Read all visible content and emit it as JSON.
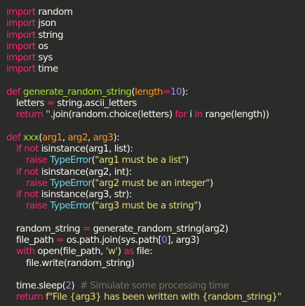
{
  "editor": {
    "background": "#2b2b29",
    "theme_colors": {
      "keyword": "#f92672",
      "function": "#a6e22e",
      "parameter": "#fd971f",
      "number": "#ae81ff",
      "string": "#e6db74",
      "builtin": "#66d9ef",
      "comment": "#75715e",
      "text": "#f8f8f2"
    },
    "lines": [
      {
        "indent": 0,
        "tokens": [
          {
            "t": "kw",
            "v": "import"
          },
          {
            "t": "plain",
            "v": " random"
          }
        ]
      },
      {
        "indent": 0,
        "tokens": [
          {
            "t": "kw",
            "v": "import"
          },
          {
            "t": "plain",
            "v": " json"
          }
        ]
      },
      {
        "indent": 0,
        "tokens": [
          {
            "t": "kw",
            "v": "import"
          },
          {
            "t": "plain",
            "v": " string"
          }
        ]
      },
      {
        "indent": 0,
        "tokens": [
          {
            "t": "kw",
            "v": "import"
          },
          {
            "t": "plain",
            "v": " os"
          }
        ]
      },
      {
        "indent": 0,
        "tokens": [
          {
            "t": "kw",
            "v": "import"
          },
          {
            "t": "plain",
            "v": " sys"
          }
        ]
      },
      {
        "indent": 0,
        "tokens": [
          {
            "t": "kw",
            "v": "import"
          },
          {
            "t": "plain",
            "v": " time"
          }
        ]
      },
      {
        "indent": 0,
        "tokens": []
      },
      {
        "indent": 0,
        "tokens": [
          {
            "t": "kw",
            "v": "def"
          },
          {
            "t": "plain",
            "v": " "
          },
          {
            "t": "fn",
            "v": "generate_random_string"
          },
          {
            "t": "plain",
            "v": "("
          },
          {
            "t": "param",
            "v": "length"
          },
          {
            "t": "kw",
            "v": "="
          },
          {
            "t": "num",
            "v": "10"
          },
          {
            "t": "plain",
            "v": "):"
          }
        ]
      },
      {
        "indent": 1,
        "tokens": [
          {
            "t": "plain",
            "v": "letters "
          },
          {
            "t": "kw",
            "v": "="
          },
          {
            "t": "plain",
            "v": " string.ascii_letters"
          }
        ]
      },
      {
        "indent": 1,
        "tokens": [
          {
            "t": "kw",
            "v": "return"
          },
          {
            "t": "plain",
            "v": " "
          },
          {
            "t": "str",
            "v": "''"
          },
          {
            "t": "plain",
            "v": ".join(random.choice(letters) "
          },
          {
            "t": "kw",
            "v": "for"
          },
          {
            "t": "plain",
            "v": " i "
          },
          {
            "t": "kw",
            "v": "in"
          },
          {
            "t": "plain",
            "v": " range(length))"
          }
        ]
      },
      {
        "indent": 0,
        "tokens": []
      },
      {
        "indent": 0,
        "tokens": [
          {
            "t": "kw",
            "v": "def"
          },
          {
            "t": "plain",
            "v": " "
          },
          {
            "t": "fn",
            "v": "xxx"
          },
          {
            "t": "plain",
            "v": "("
          },
          {
            "t": "param",
            "v": "arg1"
          },
          {
            "t": "plain",
            "v": ", "
          },
          {
            "t": "param",
            "v": "arg2"
          },
          {
            "t": "plain",
            "v": ", "
          },
          {
            "t": "param",
            "v": "arg3"
          },
          {
            "t": "plain",
            "v": "):"
          }
        ]
      },
      {
        "indent": 1,
        "tokens": [
          {
            "t": "kw",
            "v": "if not"
          },
          {
            "t": "plain",
            "v": " isinstance(arg1, list):"
          }
        ]
      },
      {
        "indent": 2,
        "tokens": [
          {
            "t": "kw",
            "v": "raise"
          },
          {
            "t": "plain",
            "v": " "
          },
          {
            "t": "builtin",
            "v": "TypeError"
          },
          {
            "t": "plain",
            "v": "("
          },
          {
            "t": "str",
            "v": "\"arg1 must be a list\""
          },
          {
            "t": "plain",
            "v": ")"
          }
        ]
      },
      {
        "indent": 1,
        "tokens": [
          {
            "t": "kw",
            "v": "if not"
          },
          {
            "t": "plain",
            "v": " isinstance(arg2, int):"
          }
        ]
      },
      {
        "indent": 2,
        "tokens": [
          {
            "t": "kw",
            "v": "raise"
          },
          {
            "t": "plain",
            "v": " "
          },
          {
            "t": "builtin",
            "v": "TypeError"
          },
          {
            "t": "plain",
            "v": "("
          },
          {
            "t": "str",
            "v": "\"arg2 must be an integer\""
          },
          {
            "t": "plain",
            "v": ")"
          }
        ]
      },
      {
        "indent": 1,
        "tokens": [
          {
            "t": "kw",
            "v": "if not"
          },
          {
            "t": "plain",
            "v": " isinstance(arg3, str):"
          }
        ]
      },
      {
        "indent": 2,
        "tokens": [
          {
            "t": "kw",
            "v": "raise"
          },
          {
            "t": "plain",
            "v": " "
          },
          {
            "t": "builtin",
            "v": "TypeError"
          },
          {
            "t": "plain",
            "v": "("
          },
          {
            "t": "str",
            "v": "\"arg3 must be a string\""
          },
          {
            "t": "plain",
            "v": ")"
          }
        ]
      },
      {
        "indent": 0,
        "tokens": []
      },
      {
        "indent": 1,
        "tokens": [
          {
            "t": "plain",
            "v": "random_string "
          },
          {
            "t": "kw",
            "v": "="
          },
          {
            "t": "plain",
            "v": " generate_random_string(arg2)"
          }
        ]
      },
      {
        "indent": 1,
        "tokens": [
          {
            "t": "plain",
            "v": "file_path "
          },
          {
            "t": "kw",
            "v": "="
          },
          {
            "t": "plain",
            "v": " os.path.join(sys.path["
          },
          {
            "t": "num",
            "v": "0"
          },
          {
            "t": "plain",
            "v": "], arg3)"
          }
        ]
      },
      {
        "indent": 1,
        "tokens": [
          {
            "t": "kw",
            "v": "with"
          },
          {
            "t": "plain",
            "v": " open(file_path, "
          },
          {
            "t": "str",
            "v": "'w'"
          },
          {
            "t": "plain",
            "v": ") "
          },
          {
            "t": "kw",
            "v": "as"
          },
          {
            "t": "plain",
            "v": " file:"
          }
        ]
      },
      {
        "indent": 2,
        "tokens": [
          {
            "t": "plain",
            "v": "file.write(random_string)"
          }
        ]
      },
      {
        "indent": 0,
        "tokens": []
      },
      {
        "indent": 1,
        "tokens": [
          {
            "t": "plain",
            "v": "time.sleep("
          },
          {
            "t": "num",
            "v": "2"
          },
          {
            "t": "plain",
            "v": ")  "
          },
          {
            "t": "cm",
            "v": "# Simulate some processing time"
          }
        ]
      },
      {
        "indent": 1,
        "tokens": [
          {
            "t": "kw",
            "v": "return"
          },
          {
            "t": "plain",
            "v": " "
          },
          {
            "t": "str",
            "v": "f\"File {arg3} has been written with {random_string}\""
          }
        ]
      }
    ]
  }
}
